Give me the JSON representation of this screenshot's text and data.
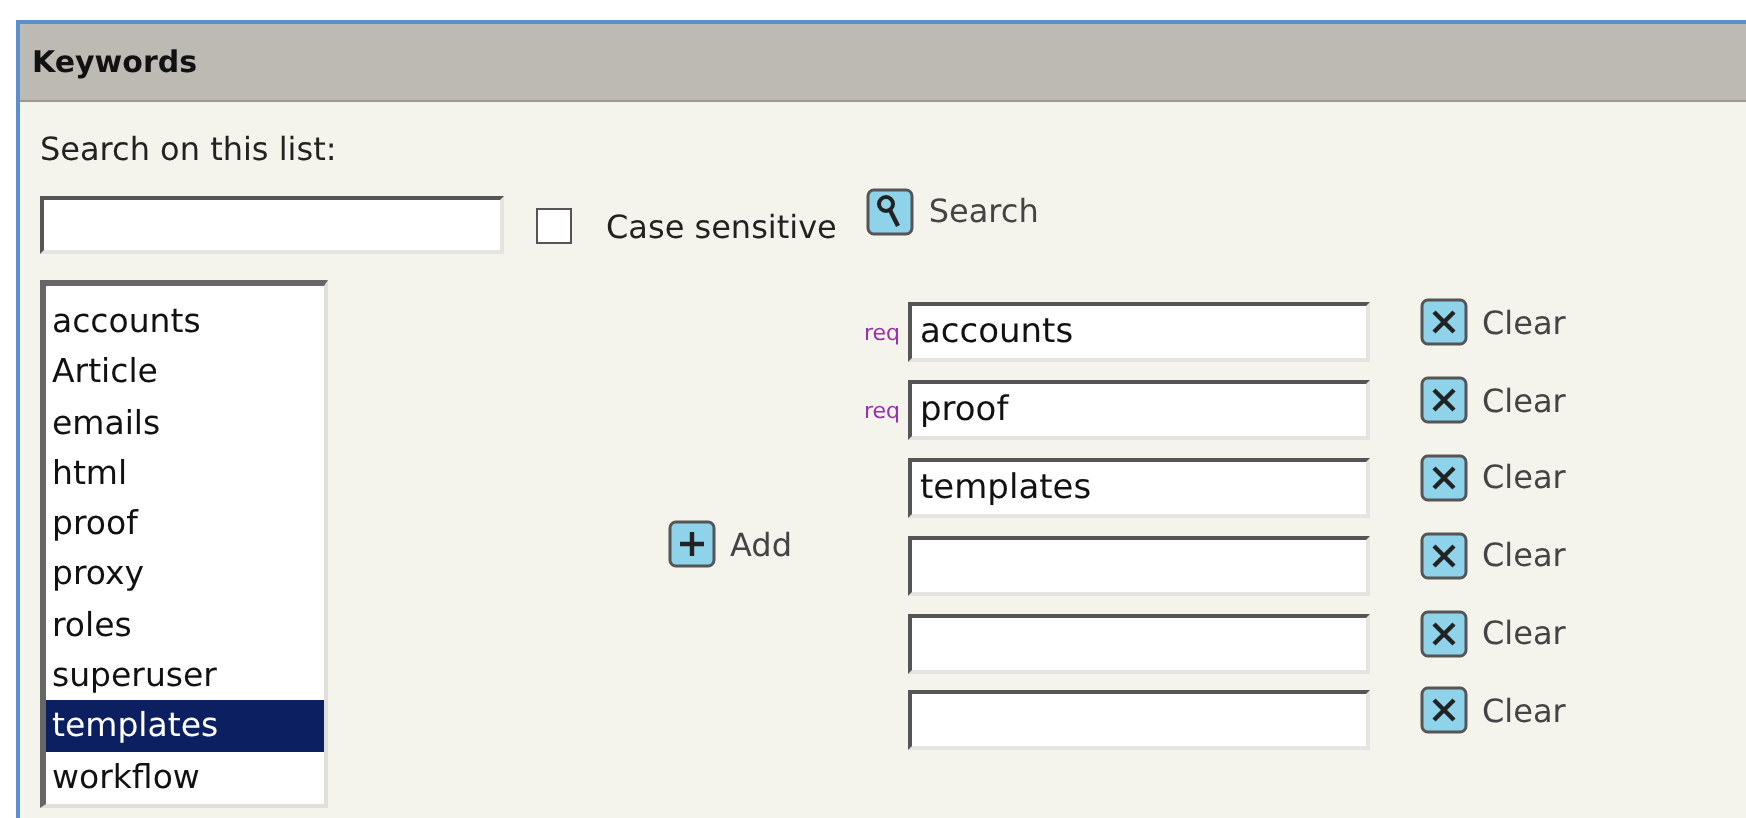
{
  "panel": {
    "title": "Keywords"
  },
  "search": {
    "label": "Search on this list:",
    "case_sensitive": {
      "label": "Case sensitive",
      "checked": false
    },
    "button": "Search"
  },
  "list": {
    "items": [
      {
        "label": "accounts",
        "selected": false
      },
      {
        "label": "Article",
        "selected": false
      },
      {
        "label": "emails",
        "selected": false
      },
      {
        "label": "html",
        "selected": false
      },
      {
        "label": "proof",
        "selected": false
      },
      {
        "label": "proxy",
        "selected": false
      },
      {
        "label": "roles",
        "selected": false
      },
      {
        "label": "superuser",
        "selected": false
      },
      {
        "label": "templates",
        "selected": true
      },
      {
        "label": "workflow",
        "selected": false
      }
    ]
  },
  "add_button": "Add",
  "keywords": [
    {
      "tag": "req",
      "value": "accounts",
      "clear": "Clear"
    },
    {
      "tag": "req",
      "value": "proof",
      "clear": "Clear"
    },
    {
      "value": "templates",
      "clear": "Clear"
    },
    {
      "clear": "Clear"
    },
    {
      "clear": "Clear"
    },
    {
      "clear": "Clear"
    }
  ]
}
